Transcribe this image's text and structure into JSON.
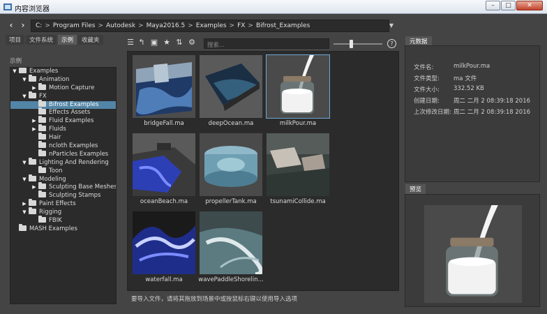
{
  "window": {
    "title": "内容浏览器",
    "controls": [
      "–",
      "□",
      "✕"
    ]
  },
  "nav": {
    "back_glyph": "‹",
    "forward_glyph": "›",
    "path": [
      "C:",
      "Program Files",
      "Autodesk",
      "Maya2016.5",
      "Examples",
      "FX",
      "Bifrost_Examples"
    ],
    "separator": ">",
    "dropdown_glyph": "▼"
  },
  "left": {
    "tabs": [
      "项目",
      "文件系统",
      "示例",
      "收藏夹"
    ],
    "active_tab": 2,
    "section_label": "示例",
    "tree": [
      {
        "label": "Examples",
        "depth": 0,
        "arrow": "▼"
      },
      {
        "label": "Animation",
        "depth": 1,
        "arrow": "▼"
      },
      {
        "label": "Motion Capture",
        "depth": 2,
        "arrow": "▶"
      },
      {
        "label": "FX",
        "depth": 1,
        "arrow": "▼"
      },
      {
        "label": "Bifrost Examples",
        "depth": 2,
        "arrow": "",
        "selected": true
      },
      {
        "label": "Effects Assets",
        "depth": 2,
        "arrow": ""
      },
      {
        "label": "Fluid Examples",
        "depth": 2,
        "arrow": "▶"
      },
      {
        "label": "Fluids",
        "depth": 2,
        "arrow": "▶"
      },
      {
        "label": "Hair",
        "depth": 2,
        "arrow": ""
      },
      {
        "label": "ncloth Examples",
        "depth": 2,
        "arrow": ""
      },
      {
        "label": "nParticles Examples",
        "depth": 2,
        "arrow": ""
      },
      {
        "label": "Lighting And Rendering",
        "depth": 1,
        "arrow": "▼"
      },
      {
        "label": "Toon",
        "depth": 2,
        "arrow": ""
      },
      {
        "label": "Modeling",
        "depth": 1,
        "arrow": "▼"
      },
      {
        "label": "Sculpting Base Meshes",
        "depth": 2,
        "arrow": "▶"
      },
      {
        "label": "Sculpting Stamps",
        "depth": 2,
        "arrow": ""
      },
      {
        "label": "Paint Effects",
        "depth": 1,
        "arrow": "▶"
      },
      {
        "label": "Rigging",
        "depth": 1,
        "arrow": "▼"
      },
      {
        "label": "FBIK",
        "depth": 2,
        "arrow": ""
      },
      {
        "label": "MASH Examples",
        "depth": 0,
        "arrow": ""
      }
    ]
  },
  "toolbar": {
    "icons": [
      "list-view-icon",
      "up-folder-icon",
      "new-folder-icon",
      "favorite-star-icon",
      "sort-icon",
      "settings-gear-icon"
    ],
    "glyphs": [
      "☰",
      "↰",
      "▣",
      "★",
      "⇅",
      "⚙"
    ],
    "search_placeholder": "搜索...",
    "thumb_size_fraction": 0.35,
    "help_glyph": "?"
  },
  "files": [
    {
      "name": "bridgeFall.ma",
      "art": "bridge"
    },
    {
      "name": "deepOcean.ma",
      "art": "ocean"
    },
    {
      "name": "milkPour.ma",
      "art": "milk",
      "selected": true
    },
    {
      "name": "oceanBeach.ma",
      "art": "beach"
    },
    {
      "name": "propellerTank.ma",
      "art": "tank"
    },
    {
      "name": "tsunamiCollide.ma",
      "art": "tsunami"
    },
    {
      "name": "waterfall.ma",
      "art": "waterfall"
    },
    {
      "name": "wavePaddleShorelin...",
      "art": "wave"
    }
  ],
  "status_text": "要导入文件，请将其拖放到场景中或按鼠标右键以使用导入选项",
  "metadata": {
    "tab": "元数据",
    "rows": [
      {
        "key": "文件名:",
        "value": "milkPour.ma"
      },
      {
        "key": "文件类型:",
        "value": "ma 文件"
      },
      {
        "key": "文件大小:",
        "value": "332.52 KB"
      },
      {
        "key": "创建日期:",
        "value": "周二 二月 2 08:39:18 2016"
      },
      {
        "key": "上次修改日期:",
        "value": "周二 二月 2 08:39:18 2016"
      }
    ]
  },
  "preview": {
    "tab": "预览"
  }
}
